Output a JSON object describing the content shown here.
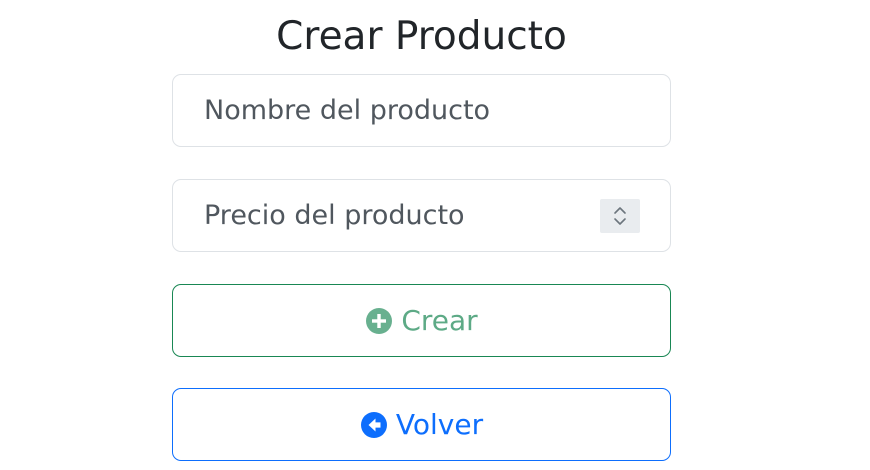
{
  "page": {
    "title": "Crear Producto"
  },
  "form": {
    "name_field": {
      "placeholder": "Nombre del producto",
      "value": ""
    },
    "price_field": {
      "placeholder": "Precio del producto",
      "value": ""
    }
  },
  "buttons": {
    "create": {
      "label": "Crear",
      "icon": "plus-circle-icon",
      "color": "#198754"
    },
    "back": {
      "label": "Volver",
      "icon": "arrow-left-circle-icon",
      "color": "#0d6efd"
    }
  }
}
